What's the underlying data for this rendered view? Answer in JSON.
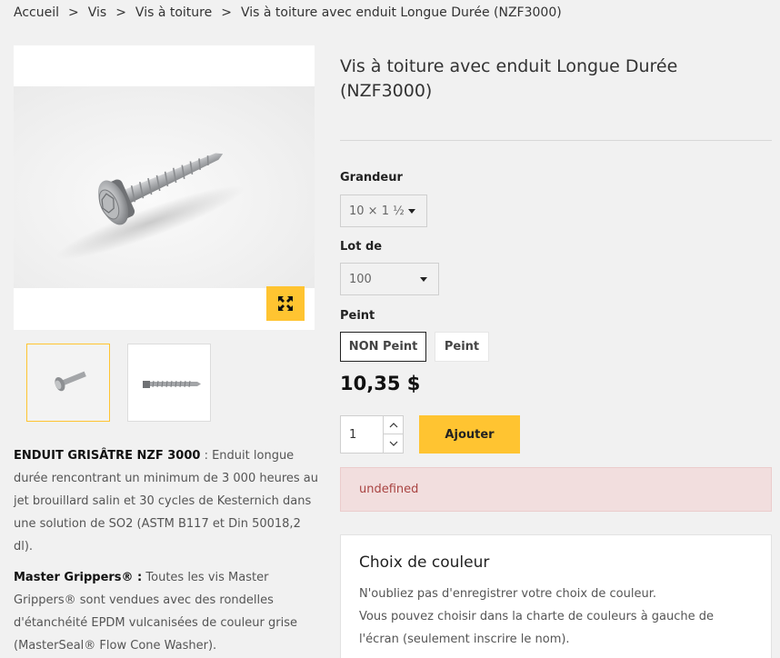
{
  "breadcrumb": {
    "items": [
      "Accueil",
      "Vis",
      "Vis à toiture",
      "Vis à toiture avec enduit Longue Durée (NZF3000)"
    ],
    "separator": ">"
  },
  "product": {
    "title": "Vis à toiture avec enduit Longue Durée (NZF3000)",
    "price": "10,35 $"
  },
  "options": {
    "grandeur_label": "Grandeur",
    "grandeur_value": "10 × 1 ½",
    "lot_label": "Lot de",
    "lot_value": "100",
    "peint_label": "Peint",
    "peint_options": [
      "NON Peint",
      "Peint"
    ],
    "peint_selected": "NON Peint"
  },
  "cart": {
    "quantity": "1",
    "add_label": "Ajouter"
  },
  "alert": {
    "text": "undefined"
  },
  "description": {
    "p1_strong": "ENDUIT GRISÂTRE NZF 3000",
    "p1_text": " : Enduit longue durée rencontrant un minimum de 3 000 heures au jet brouillard salin et 30 cycles de Kesternich dans une solution de SO2 (ASTM B117 et Din 50018,2 dl).",
    "p2_strong": "Master Grippers® :",
    "p2_text": " Toutes les vis Master Grippers® sont vendues avec des rondelles d'étanchéité EPDM vulcanisées de couleur grise (MasterSeal® Flow Cone Washer)."
  },
  "color_choice": {
    "title": "Choix de couleur",
    "line1": "N'oubliez pas d'enregistrer votre choix de couleur.",
    "line2": "Vous pouvez choisir dans la charte de couleurs à gauche de l'écran (seulement inscrire le nom)."
  },
  "colors": {
    "accent": "#ffc431",
    "alert_bg": "#f2dede",
    "alert_text": "#a94442",
    "page_bg": "#f1f1f1"
  }
}
